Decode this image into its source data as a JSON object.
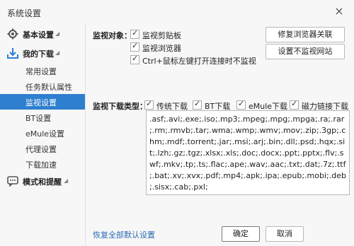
{
  "window": {
    "title": "系统设置",
    "close_label": "×"
  },
  "sidebar": {
    "section_basic": {
      "label": "基本设置"
    },
    "section_download": {
      "label": "我的下载"
    },
    "items": [
      {
        "label": "常用设置"
      },
      {
        "label": "任务默认属性"
      },
      {
        "label": "监视设置"
      },
      {
        "label": "BT设置"
      },
      {
        "label": "eMule设置"
      },
      {
        "label": "代理设置"
      },
      {
        "label": "下载加速"
      }
    ],
    "section_mode": {
      "label": "模式和提醒"
    }
  },
  "monitor": {
    "heading": "监视对象：",
    "options": [
      {
        "label": "监视剪贴板",
        "checked": true
      },
      {
        "label": "监视浏览器",
        "checked": true
      },
      {
        "label": "Ctrl+鼠标左键打开连接时不监视",
        "checked": true
      }
    ],
    "fix_browser_button": "修复浏览器关联",
    "no_monitor_site_button": "设置不监视网站"
  },
  "download_types": {
    "heading": "监视下载类型：",
    "options": [
      {
        "label": "传统下载",
        "checked": true
      },
      {
        "label": "BT下载",
        "checked": true
      },
      {
        "label": "eMule下载",
        "checked": true
      },
      {
        "label": "磁力链接下载",
        "checked": true
      }
    ],
    "extensions": ".asf;.avi;.exe;.iso;.mp3;.mpeg;.mpg;.mpga;.ra;.rar;.rm;.rmvb;.tar;.wma;.wmp;.wmv;.mov;.zip;.3gp;.chm;.mdf;.torrent;.jar;.msi;.arj;.bin;.dll;.psd;.hqx;.sit;.lzh;.gz;.tgz;.xlsx;.xls;.doc;.docx;.ppt;.pptx;.flv;.swf;.mkv;.tp;.ts;.flac;.ape;.wav;.aac;.txt;.dat;.7z;.ttf;.bat;.xv;.xvx;.pdf;.mp4;.apk;.ipa;.epub;.mobi;.deb;.sisx;.cab;.pxl;"
  },
  "footer": {
    "restore_link": "恢复全部默认设置",
    "ok_button": "确定",
    "cancel_button": "取消"
  }
}
